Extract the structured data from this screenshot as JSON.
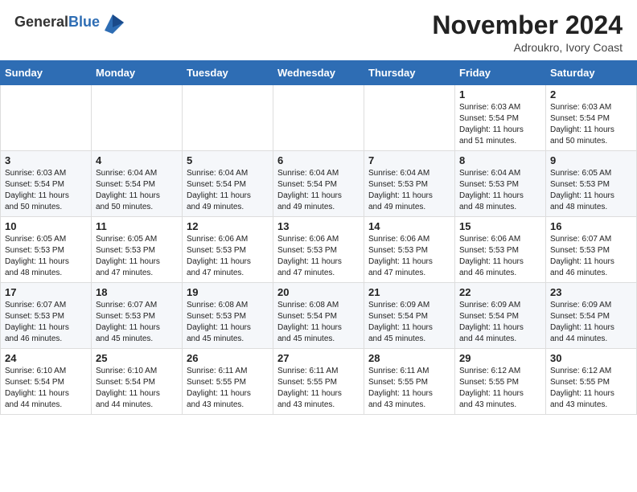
{
  "header": {
    "logo_general": "General",
    "logo_blue": "Blue",
    "month_title": "November 2024",
    "location": "Adroukro, Ivory Coast"
  },
  "weekdays": [
    "Sunday",
    "Monday",
    "Tuesday",
    "Wednesday",
    "Thursday",
    "Friday",
    "Saturday"
  ],
  "weeks": [
    [
      {
        "day": "",
        "info": ""
      },
      {
        "day": "",
        "info": ""
      },
      {
        "day": "",
        "info": ""
      },
      {
        "day": "",
        "info": ""
      },
      {
        "day": "",
        "info": ""
      },
      {
        "day": "1",
        "info": "Sunrise: 6:03 AM\nSunset: 5:54 PM\nDaylight: 11 hours\nand 51 minutes."
      },
      {
        "day": "2",
        "info": "Sunrise: 6:03 AM\nSunset: 5:54 PM\nDaylight: 11 hours\nand 50 minutes."
      }
    ],
    [
      {
        "day": "3",
        "info": "Sunrise: 6:03 AM\nSunset: 5:54 PM\nDaylight: 11 hours\nand 50 minutes."
      },
      {
        "day": "4",
        "info": "Sunrise: 6:04 AM\nSunset: 5:54 PM\nDaylight: 11 hours\nand 50 minutes."
      },
      {
        "day": "5",
        "info": "Sunrise: 6:04 AM\nSunset: 5:54 PM\nDaylight: 11 hours\nand 49 minutes."
      },
      {
        "day": "6",
        "info": "Sunrise: 6:04 AM\nSunset: 5:54 PM\nDaylight: 11 hours\nand 49 minutes."
      },
      {
        "day": "7",
        "info": "Sunrise: 6:04 AM\nSunset: 5:53 PM\nDaylight: 11 hours\nand 49 minutes."
      },
      {
        "day": "8",
        "info": "Sunrise: 6:04 AM\nSunset: 5:53 PM\nDaylight: 11 hours\nand 48 minutes."
      },
      {
        "day": "9",
        "info": "Sunrise: 6:05 AM\nSunset: 5:53 PM\nDaylight: 11 hours\nand 48 minutes."
      }
    ],
    [
      {
        "day": "10",
        "info": "Sunrise: 6:05 AM\nSunset: 5:53 PM\nDaylight: 11 hours\nand 48 minutes."
      },
      {
        "day": "11",
        "info": "Sunrise: 6:05 AM\nSunset: 5:53 PM\nDaylight: 11 hours\nand 47 minutes."
      },
      {
        "day": "12",
        "info": "Sunrise: 6:06 AM\nSunset: 5:53 PM\nDaylight: 11 hours\nand 47 minutes."
      },
      {
        "day": "13",
        "info": "Sunrise: 6:06 AM\nSunset: 5:53 PM\nDaylight: 11 hours\nand 47 minutes."
      },
      {
        "day": "14",
        "info": "Sunrise: 6:06 AM\nSunset: 5:53 PM\nDaylight: 11 hours\nand 47 minutes."
      },
      {
        "day": "15",
        "info": "Sunrise: 6:06 AM\nSunset: 5:53 PM\nDaylight: 11 hours\nand 46 minutes."
      },
      {
        "day": "16",
        "info": "Sunrise: 6:07 AM\nSunset: 5:53 PM\nDaylight: 11 hours\nand 46 minutes."
      }
    ],
    [
      {
        "day": "17",
        "info": "Sunrise: 6:07 AM\nSunset: 5:53 PM\nDaylight: 11 hours\nand 46 minutes."
      },
      {
        "day": "18",
        "info": "Sunrise: 6:07 AM\nSunset: 5:53 PM\nDaylight: 11 hours\nand 45 minutes."
      },
      {
        "day": "19",
        "info": "Sunrise: 6:08 AM\nSunset: 5:53 PM\nDaylight: 11 hours\nand 45 minutes."
      },
      {
        "day": "20",
        "info": "Sunrise: 6:08 AM\nSunset: 5:54 PM\nDaylight: 11 hours\nand 45 minutes."
      },
      {
        "day": "21",
        "info": "Sunrise: 6:09 AM\nSunset: 5:54 PM\nDaylight: 11 hours\nand 45 minutes."
      },
      {
        "day": "22",
        "info": "Sunrise: 6:09 AM\nSunset: 5:54 PM\nDaylight: 11 hours\nand 44 minutes."
      },
      {
        "day": "23",
        "info": "Sunrise: 6:09 AM\nSunset: 5:54 PM\nDaylight: 11 hours\nand 44 minutes."
      }
    ],
    [
      {
        "day": "24",
        "info": "Sunrise: 6:10 AM\nSunset: 5:54 PM\nDaylight: 11 hours\nand 44 minutes."
      },
      {
        "day": "25",
        "info": "Sunrise: 6:10 AM\nSunset: 5:54 PM\nDaylight: 11 hours\nand 44 minutes."
      },
      {
        "day": "26",
        "info": "Sunrise: 6:11 AM\nSunset: 5:55 PM\nDaylight: 11 hours\nand 43 minutes."
      },
      {
        "day": "27",
        "info": "Sunrise: 6:11 AM\nSunset: 5:55 PM\nDaylight: 11 hours\nand 43 minutes."
      },
      {
        "day": "28",
        "info": "Sunrise: 6:11 AM\nSunset: 5:55 PM\nDaylight: 11 hours\nand 43 minutes."
      },
      {
        "day": "29",
        "info": "Sunrise: 6:12 AM\nSunset: 5:55 PM\nDaylight: 11 hours\nand 43 minutes."
      },
      {
        "day": "30",
        "info": "Sunrise: 6:12 AM\nSunset: 5:55 PM\nDaylight: 11 hours\nand 43 minutes."
      }
    ]
  ]
}
